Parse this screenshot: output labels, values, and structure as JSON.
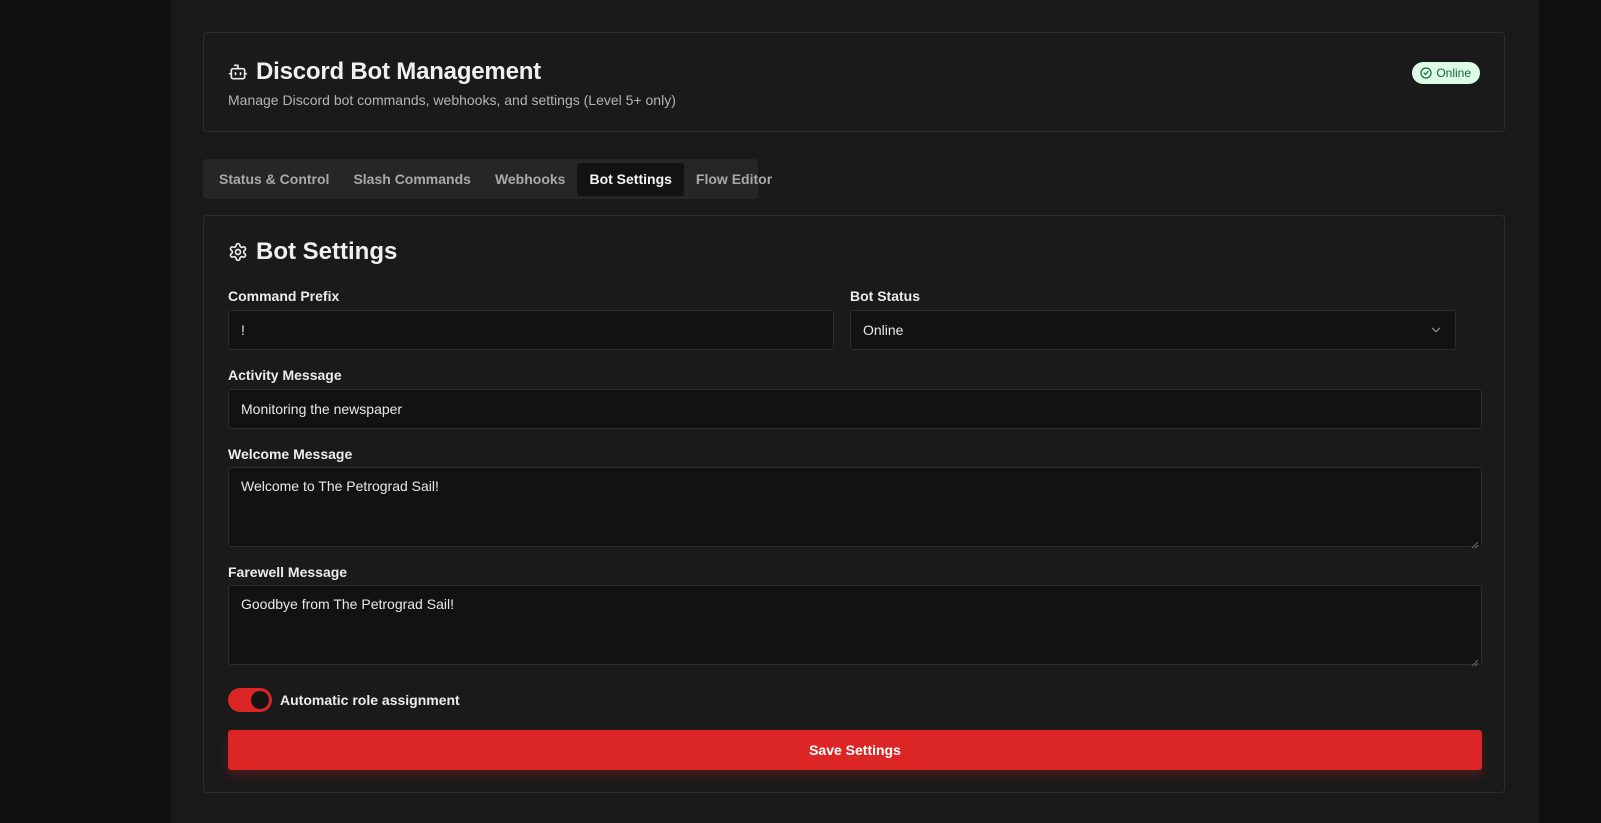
{
  "header": {
    "title": "Discord Bot Management",
    "subtitle": "Manage Discord bot commands, webhooks, and settings (Level 5+ only)",
    "status_badge": "Online",
    "icon": "bot-icon"
  },
  "tabs": [
    {
      "label": "Status & Control",
      "active": false
    },
    {
      "label": "Slash Commands",
      "active": false
    },
    {
      "label": "Webhooks",
      "active": false
    },
    {
      "label": "Bot Settings",
      "active": true
    },
    {
      "label": "Flow Editor",
      "active": false
    }
  ],
  "settings": {
    "title": "Bot Settings",
    "icon": "gear-icon",
    "command_prefix": {
      "label": "Command Prefix",
      "value": "!"
    },
    "bot_status": {
      "label": "Bot Status",
      "value": "Online"
    },
    "activity_message": {
      "label": "Activity Message",
      "value": "Monitoring the newspaper"
    },
    "welcome_message": {
      "label": "Welcome Message",
      "value": "Welcome to The Petrograd Sail!"
    },
    "farewell_message": {
      "label": "Farewell Message",
      "value": "Goodbye from The Petrograd Sail!"
    },
    "auto_role": {
      "label": "Automatic role assignment",
      "enabled": true
    },
    "save_label": "Save Settings"
  },
  "colors": {
    "accent": "#dc2626",
    "badge_bg": "#dcfce7",
    "badge_text": "#166534"
  }
}
